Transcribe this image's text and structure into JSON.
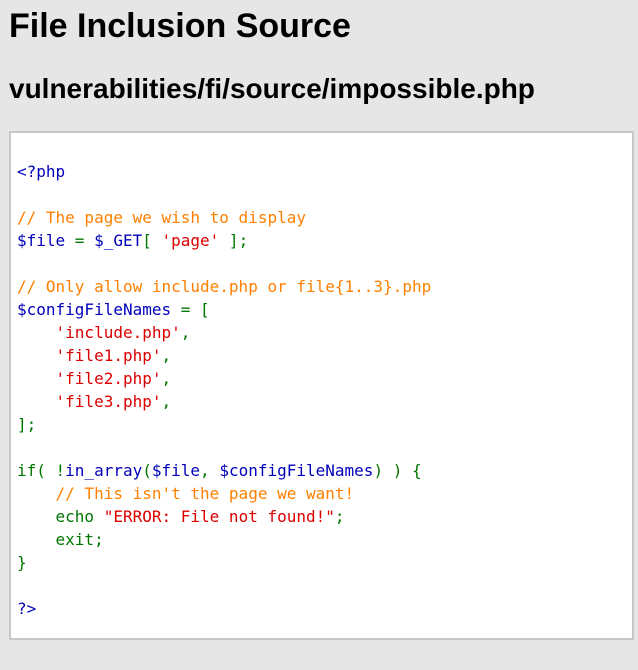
{
  "page": {
    "title": "File Inclusion Source",
    "file_path": "vulnerabilities/fi/source/impossible.php"
  },
  "colors": {
    "background": "#e6e6e6",
    "code_background": "#ffffff",
    "code_border": "#c8c8c8",
    "php_default": "#0000BB",
    "php_keyword": "#007700",
    "php_string": "#DD0000",
    "php_comment": "#FF8000"
  },
  "code": {
    "lines": [
      [
        {
          "t": "<?php",
          "c": "default"
        }
      ],
      [],
      [
        {
          "t": "// The page we wish to display",
          "c": "comment"
        }
      ],
      [
        {
          "t": "$file ",
          "c": "default"
        },
        {
          "t": "= ",
          "c": "keyword"
        },
        {
          "t": "$_GET",
          "c": "default"
        },
        {
          "t": "[ ",
          "c": "keyword"
        },
        {
          "t": "'page'",
          "c": "string"
        },
        {
          "t": " ];",
          "c": "keyword"
        }
      ],
      [],
      [
        {
          "t": "// Only allow include.php or file{1..3}.php",
          "c": "comment"
        }
      ],
      [
        {
          "t": "$configFileNames ",
          "c": "default"
        },
        {
          "t": "= [",
          "c": "keyword"
        }
      ],
      [
        {
          "t": "    ",
          "c": "keyword"
        },
        {
          "t": "'include.php'",
          "c": "string"
        },
        {
          "t": ",",
          "c": "keyword"
        }
      ],
      [
        {
          "t": "    ",
          "c": "keyword"
        },
        {
          "t": "'file1.php'",
          "c": "string"
        },
        {
          "t": ",",
          "c": "keyword"
        }
      ],
      [
        {
          "t": "    ",
          "c": "keyword"
        },
        {
          "t": "'file2.php'",
          "c": "string"
        },
        {
          "t": ",",
          "c": "keyword"
        }
      ],
      [
        {
          "t": "    ",
          "c": "keyword"
        },
        {
          "t": "'file3.php'",
          "c": "string"
        },
        {
          "t": ",",
          "c": "keyword"
        }
      ],
      [
        {
          "t": "];",
          "c": "keyword"
        }
      ],
      [],
      [
        {
          "t": "if( !",
          "c": "keyword"
        },
        {
          "t": "in_array",
          "c": "default"
        },
        {
          "t": "(",
          "c": "keyword"
        },
        {
          "t": "$file",
          "c": "default"
        },
        {
          "t": ", ",
          "c": "keyword"
        },
        {
          "t": "$configFileNames",
          "c": "default"
        },
        {
          "t": ") ) {",
          "c": "keyword"
        }
      ],
      [
        {
          "t": "    ",
          "c": "keyword"
        },
        {
          "t": "// This isn't the page we want!",
          "c": "comment"
        }
      ],
      [
        {
          "t": "    echo ",
          "c": "keyword"
        },
        {
          "t": "\"ERROR: File not found!\"",
          "c": "string"
        },
        {
          "t": ";",
          "c": "keyword"
        }
      ],
      [
        {
          "t": "    exit;",
          "c": "keyword"
        }
      ],
      [
        {
          "t": "}",
          "c": "keyword"
        }
      ],
      [],
      [
        {
          "t": "?>",
          "c": "default"
        }
      ]
    ]
  }
}
